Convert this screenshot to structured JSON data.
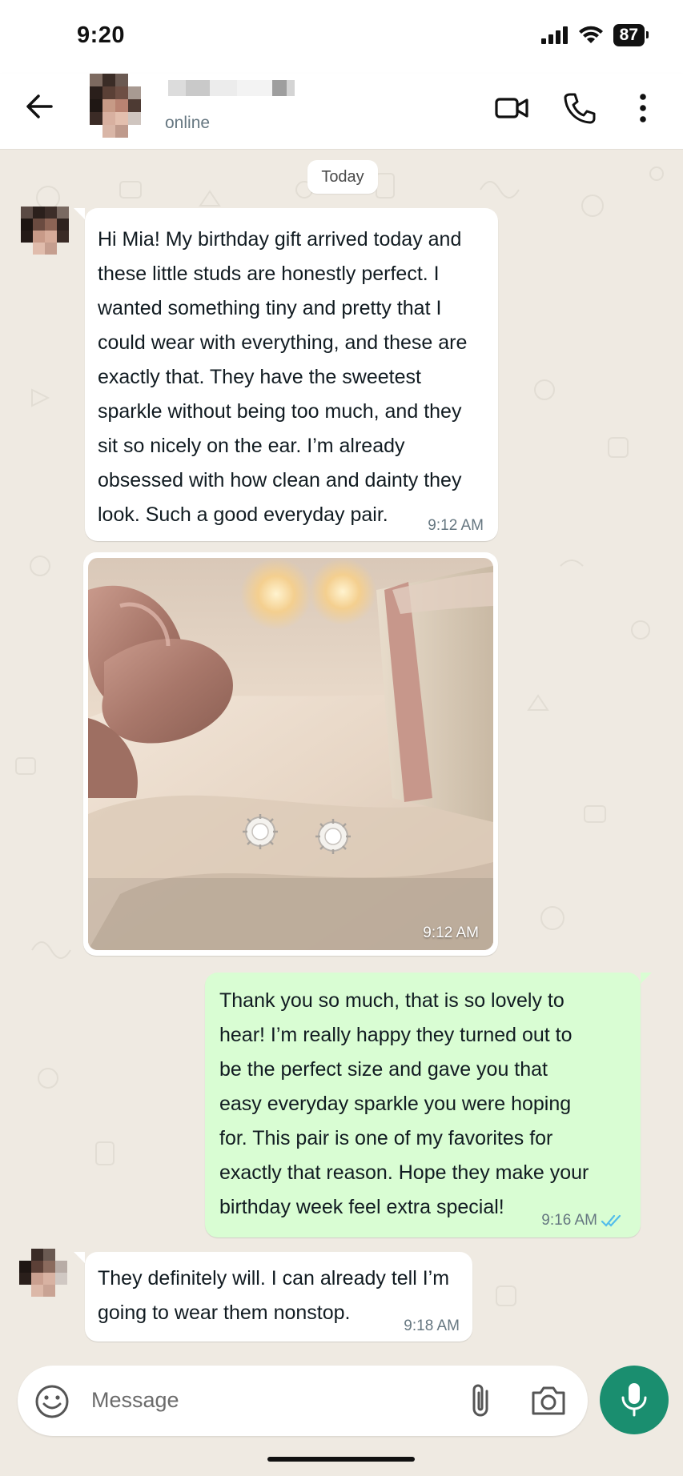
{
  "status_bar": {
    "time": "9:20",
    "battery": "87"
  },
  "header": {
    "contact_status": "online"
  },
  "chat": {
    "date_label": "Today",
    "messages": [
      {
        "direction": "in",
        "text": "Hi Mia! My birthday gift arrived today and\nthese little studs are honestly perfect. I\nwanted something tiny and pretty that I\ncould wear with everything, and these are\nexactly that. They have the sweetest\nsparkle without being too much, and they\nsit so nicely on the ear. I’m already\nobsessed with how clean and dainty they\nlook. Such a good everyday pair.",
        "time": "9:12 AM"
      },
      {
        "direction": "in",
        "type": "image",
        "time": "9:12 AM"
      },
      {
        "direction": "out",
        "text": "Thank you so much, that is so lovely to\nhear! I’m really happy they turned out to\nbe the perfect size and gave you that\neasy everyday sparkle you were hoping\nfor. This pair is one of my favorites for\nexactly that reason. Hope they make your\nbirthday week feel extra special!",
        "time": "9:16 AM",
        "read": true
      },
      {
        "direction": "in",
        "text": "They definitely will. I can already tell I’m\ngoing to wear them nonstop.",
        "time": "9:18 AM"
      }
    ]
  },
  "composer": {
    "placeholder": "Message"
  },
  "colors": {
    "accent": "#1a8e6f",
    "outgoing_bubble": "#d9fdd3",
    "chat_background": "#efeae2",
    "read_ticks": "#53bdeb"
  }
}
